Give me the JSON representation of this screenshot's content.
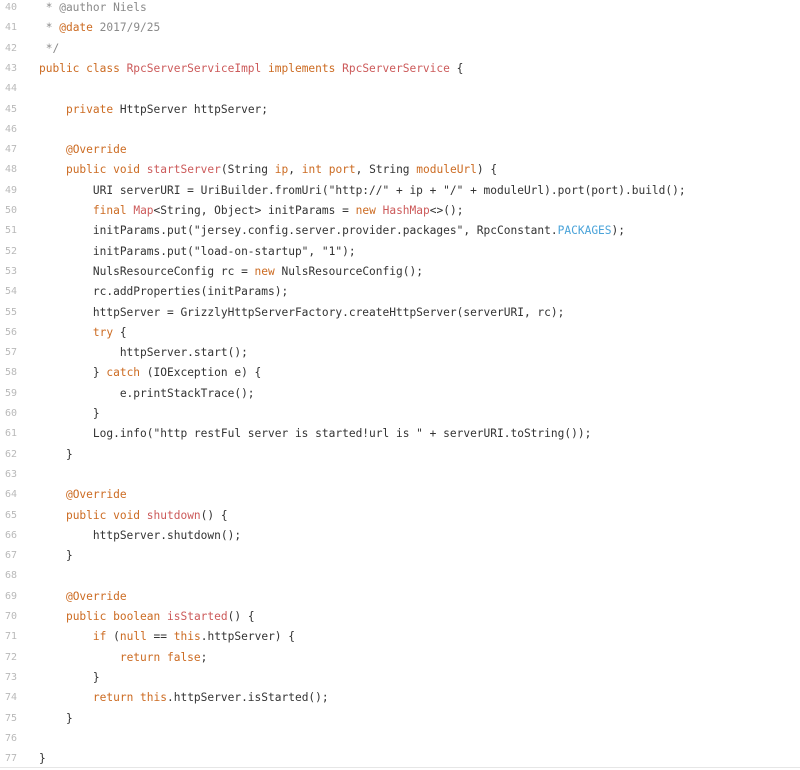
{
  "code": {
    "lines": [
      {
        "n": "40",
        "tokens": [
          {
            "t": " * @author Niels",
            "c": "cmt"
          }
        ]
      },
      {
        "n": "41",
        "tokens": [
          {
            "t": " * ",
            "c": "cmt"
          },
          {
            "t": "@date",
            "c": "ann"
          },
          {
            "t": " 2017/9/25",
            "c": "cmt"
          }
        ]
      },
      {
        "n": "42",
        "tokens": [
          {
            "t": " */",
            "c": "cmt"
          }
        ]
      },
      {
        "n": "43",
        "tokens": [
          {
            "t": "public class ",
            "c": "kw"
          },
          {
            "t": "RpcServerServiceImpl",
            "c": "type"
          },
          {
            "t": " implements ",
            "c": "kw"
          },
          {
            "t": "RpcServerService",
            "c": "type"
          },
          {
            "t": " {",
            "c": "plain"
          }
        ]
      },
      {
        "n": "44",
        "tokens": []
      },
      {
        "n": "45",
        "tokens": [
          {
            "t": "    ",
            "c": "plain"
          },
          {
            "t": "private",
            "c": "kw"
          },
          {
            "t": " HttpServer httpServer;",
            "c": "plain"
          }
        ]
      },
      {
        "n": "46",
        "tokens": []
      },
      {
        "n": "47",
        "tokens": [
          {
            "t": "    ",
            "c": "plain"
          },
          {
            "t": "@Override",
            "c": "ann"
          }
        ]
      },
      {
        "n": "48",
        "tokens": [
          {
            "t": "    ",
            "c": "plain"
          },
          {
            "t": "public void ",
            "c": "kw"
          },
          {
            "t": "startServer",
            "c": "type"
          },
          {
            "t": "(String ",
            "c": "plain"
          },
          {
            "t": "ip",
            "c": "kw"
          },
          {
            "t": ", ",
            "c": "plain"
          },
          {
            "t": "int",
            "c": "kw"
          },
          {
            "t": " ",
            "c": "plain"
          },
          {
            "t": "port",
            "c": "kw"
          },
          {
            "t": ", String ",
            "c": "plain"
          },
          {
            "t": "moduleUrl",
            "c": "kw"
          },
          {
            "t": ") {",
            "c": "plain"
          }
        ]
      },
      {
        "n": "49",
        "tokens": [
          {
            "t": "        URI serverURI = UriBuilder.fromUri(\"http://\" + ip + \"/\" + moduleUrl).port(port).build();",
            "c": "plain"
          }
        ]
      },
      {
        "n": "50",
        "tokens": [
          {
            "t": "        ",
            "c": "plain"
          },
          {
            "t": "final",
            "c": "kw"
          },
          {
            "t": " ",
            "c": "plain"
          },
          {
            "t": "Map",
            "c": "type"
          },
          {
            "t": "<String, Object> initParams = ",
            "c": "plain"
          },
          {
            "t": "new",
            "c": "kw"
          },
          {
            "t": " ",
            "c": "plain"
          },
          {
            "t": "HashMap",
            "c": "type"
          },
          {
            "t": "<>();",
            "c": "plain"
          }
        ]
      },
      {
        "n": "51",
        "tokens": [
          {
            "t": "        initParams.put(\"jersey.config.server.provider.packages\", RpcConstant.",
            "c": "plain"
          },
          {
            "t": "PACKAGES",
            "c": "const"
          },
          {
            "t": ");",
            "c": "plain"
          }
        ]
      },
      {
        "n": "52",
        "tokens": [
          {
            "t": "        initParams.put(\"load-on-startup\", \"1\");",
            "c": "plain"
          }
        ]
      },
      {
        "n": "53",
        "tokens": [
          {
            "t": "        NulsResourceConfig rc = ",
            "c": "plain"
          },
          {
            "t": "new",
            "c": "kw"
          },
          {
            "t": " NulsResourceConfig();",
            "c": "plain"
          }
        ]
      },
      {
        "n": "54",
        "tokens": [
          {
            "t": "        rc.addProperties(initParams);",
            "c": "plain"
          }
        ]
      },
      {
        "n": "55",
        "tokens": [
          {
            "t": "        httpServer = GrizzlyHttpServerFactory.createHttpServer(serverURI, rc);",
            "c": "plain"
          }
        ]
      },
      {
        "n": "56",
        "tokens": [
          {
            "t": "        ",
            "c": "plain"
          },
          {
            "t": "try",
            "c": "kw"
          },
          {
            "t": " {",
            "c": "plain"
          }
        ]
      },
      {
        "n": "57",
        "tokens": [
          {
            "t": "            httpServer.start();",
            "c": "plain"
          }
        ]
      },
      {
        "n": "58",
        "tokens": [
          {
            "t": "        } ",
            "c": "plain"
          },
          {
            "t": "catch",
            "c": "kw"
          },
          {
            "t": " (IOException e) {",
            "c": "plain"
          }
        ]
      },
      {
        "n": "59",
        "tokens": [
          {
            "t": "            e.printStackTrace();",
            "c": "plain"
          }
        ]
      },
      {
        "n": "60",
        "tokens": [
          {
            "t": "        }",
            "c": "plain"
          }
        ]
      },
      {
        "n": "61",
        "tokens": [
          {
            "t": "        Log.info(\"http restFul server is started!url is \" + serverURI.toString());",
            "c": "plain"
          }
        ]
      },
      {
        "n": "62",
        "tokens": [
          {
            "t": "    }",
            "c": "plain"
          }
        ]
      },
      {
        "n": "63",
        "tokens": []
      },
      {
        "n": "64",
        "tokens": [
          {
            "t": "    ",
            "c": "plain"
          },
          {
            "t": "@Override",
            "c": "ann"
          }
        ]
      },
      {
        "n": "65",
        "tokens": [
          {
            "t": "    ",
            "c": "plain"
          },
          {
            "t": "public void ",
            "c": "kw"
          },
          {
            "t": "shutdown",
            "c": "type"
          },
          {
            "t": "() {",
            "c": "plain"
          }
        ]
      },
      {
        "n": "66",
        "tokens": [
          {
            "t": "        httpServer.shutdown();",
            "c": "plain"
          }
        ]
      },
      {
        "n": "67",
        "tokens": [
          {
            "t": "    }",
            "c": "plain"
          }
        ]
      },
      {
        "n": "68",
        "tokens": []
      },
      {
        "n": "69",
        "tokens": [
          {
            "t": "    ",
            "c": "plain"
          },
          {
            "t": "@Override",
            "c": "ann"
          }
        ]
      },
      {
        "n": "70",
        "tokens": [
          {
            "t": "    ",
            "c": "plain"
          },
          {
            "t": "public boolean ",
            "c": "kw"
          },
          {
            "t": "isStarted",
            "c": "type"
          },
          {
            "t": "() {",
            "c": "plain"
          }
        ]
      },
      {
        "n": "71",
        "tokens": [
          {
            "t": "        ",
            "c": "plain"
          },
          {
            "t": "if",
            "c": "kw"
          },
          {
            "t": " (",
            "c": "plain"
          },
          {
            "t": "null",
            "c": "kw"
          },
          {
            "t": " == ",
            "c": "plain"
          },
          {
            "t": "this",
            "c": "kw"
          },
          {
            "t": ".httpServer) {",
            "c": "plain"
          }
        ]
      },
      {
        "n": "72",
        "tokens": [
          {
            "t": "            ",
            "c": "plain"
          },
          {
            "t": "return false",
            "c": "kw"
          },
          {
            "t": ";",
            "c": "plain"
          }
        ]
      },
      {
        "n": "73",
        "tokens": [
          {
            "t": "        }",
            "c": "plain"
          }
        ]
      },
      {
        "n": "74",
        "tokens": [
          {
            "t": "        ",
            "c": "plain"
          },
          {
            "t": "return this",
            "c": "kw"
          },
          {
            "t": ".httpServer.isStarted();",
            "c": "plain"
          }
        ]
      },
      {
        "n": "75",
        "tokens": [
          {
            "t": "    }",
            "c": "plain"
          }
        ]
      },
      {
        "n": "76",
        "tokens": []
      },
      {
        "n": "77",
        "tokens": [
          {
            "t": "}",
            "c": "plain"
          }
        ]
      }
    ]
  }
}
